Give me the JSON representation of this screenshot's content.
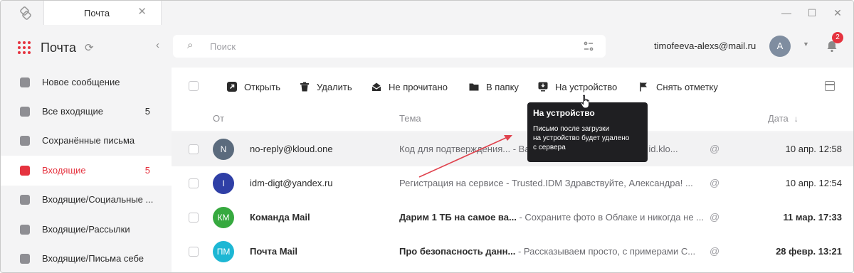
{
  "titlebar": {
    "tab_label": "Почта",
    "tab_close": "✕",
    "minimize": "—",
    "maximize": "☐",
    "close": "✕"
  },
  "sidebar": {
    "title": "Почта",
    "items": [
      {
        "label": "Новое сообщение",
        "count": "",
        "icon": "plus-icon",
        "active": false
      },
      {
        "label": "Все входящие",
        "count": "5",
        "icon": "inbox-tray-icon",
        "active": false
      },
      {
        "label": "Сохранённые письма",
        "count": "",
        "icon": "save-icon",
        "active": false
      },
      {
        "label": "Входящие",
        "count": "5",
        "icon": "envelope-icon",
        "active": true
      },
      {
        "label": "Входящие/Социальные ...",
        "count": "",
        "icon": "folder-icon",
        "active": false
      },
      {
        "label": "Входящие/Рассылки",
        "count": "",
        "icon": "folder-icon",
        "active": false
      },
      {
        "label": "Входящие/Письма себе",
        "count": "",
        "icon": "folder-icon",
        "active": false
      }
    ]
  },
  "search": {
    "placeholder": "Поиск"
  },
  "account": {
    "email": "timofeeva-alexs@mail.ru",
    "avatar_letter": "A",
    "notifications": "2"
  },
  "toolbar": {
    "items": [
      {
        "label": "Открыть",
        "icon": "open-arrow-icon"
      },
      {
        "label": "Удалить",
        "icon": "trash-icon"
      },
      {
        "label": "Не прочитано",
        "icon": "open-envelope-icon"
      },
      {
        "label": "В папку",
        "icon": "folder-icon"
      },
      {
        "label": "На устройство",
        "icon": "device-download-icon"
      },
      {
        "label": "Снять отметку",
        "icon": "flag-icon"
      }
    ]
  },
  "list_header": {
    "from": "От",
    "subject": "Тема",
    "date": "Дата"
  },
  "messages": [
    {
      "avatar": "N",
      "avatar_color": "#5b6b7d",
      "sender": "no-reply@kloud.one",
      "subject": "Код для подтверждения...",
      "snippet": " - Ваш код (no-reply@kloud.one) id.klo...",
      "date": "10 апр. 12:58",
      "unread": false
    },
    {
      "avatar": "I",
      "avatar_color": "#2f3fa6",
      "sender": "idm-digt@yandex.ru",
      "subject": "Регистрация на сервисе",
      "snippet": " -  Trusted.IDM Здравствуйте, Александра! ...",
      "date": "10 апр. 12:54",
      "unread": false
    },
    {
      "avatar": "КМ",
      "avatar_color": "#36a93f",
      "sender": "Команда Mail",
      "subject": "Дарим 1 ТБ на самое ва...",
      "snippet": " - Сохраните фото в Облаке и никогда не ...",
      "date": "11 мар. 17:33",
      "unread": true
    },
    {
      "avatar": "ПМ",
      "avatar_color": "#1db7d4",
      "sender": "Почта Mail",
      "subject": "Про безопасность данн...",
      "snippet": " - Рассказываем просто, с примерами  С...",
      "date": "28 февр. 13:21",
      "unread": true
    }
  ],
  "tooltip": {
    "title": "На устройство",
    "text_1": "Письмо после загрузки",
    "text_2": "на устройство будет удалено",
    "text_3": "с сервера"
  },
  "colors": {
    "accent": "#e5333f",
    "tooltip_bg": "#1f1f22",
    "annotation_arrow": "#e0434e"
  }
}
